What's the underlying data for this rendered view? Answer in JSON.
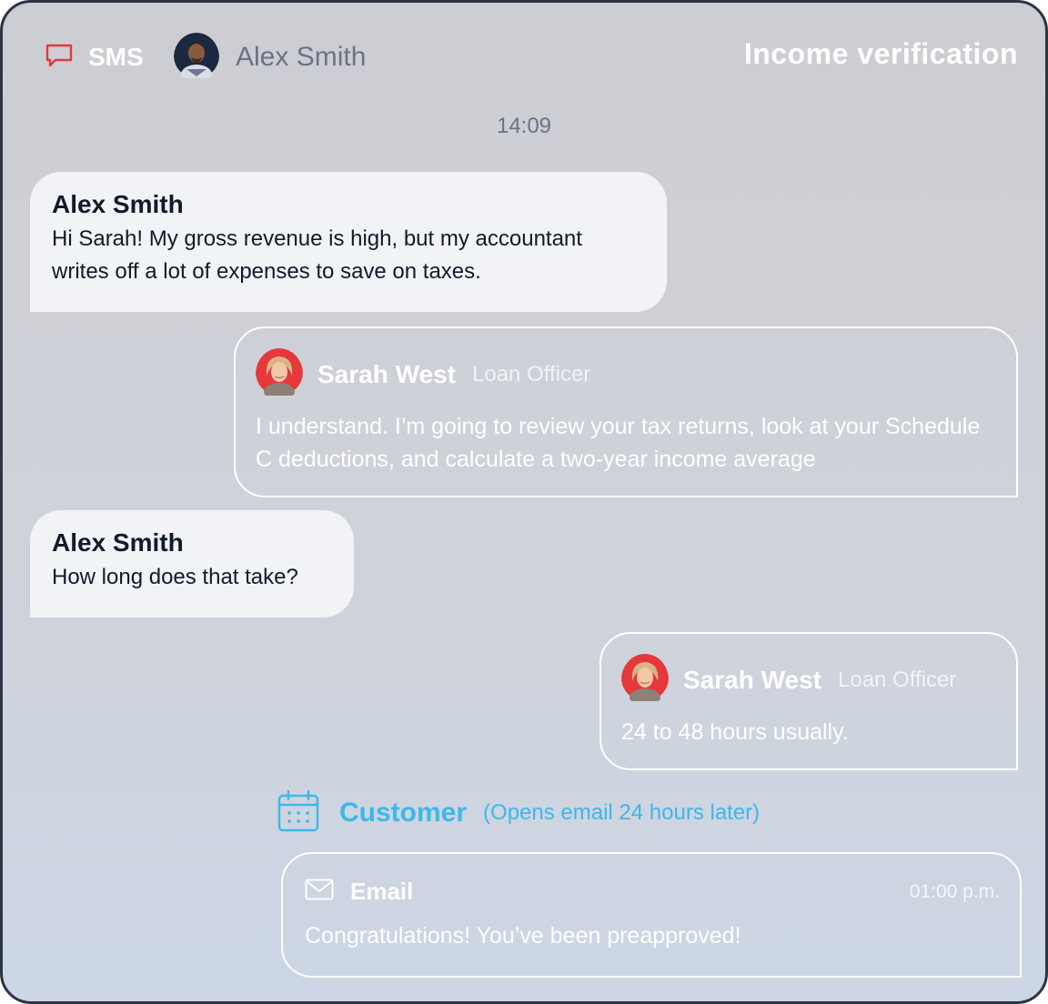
{
  "header": {
    "channel_label": "SMS",
    "channel_icon": "chat-bubble-icon",
    "contact_name": "Alex Smith",
    "title": "Income verification"
  },
  "timestamp": "14:09",
  "messages": [
    {
      "direction": "incoming",
      "sender": "Alex Smith",
      "text": "Hi Sarah! My gross revenue is high, but my accountant writes off a lot of expenses to save on taxes."
    },
    {
      "direction": "outgoing",
      "sender": "Sarah West",
      "role": "Loan Officer",
      "text": "I understand. I’m going to review your tax returns, look at your Schedule C deductions, and calculate a two-year income average"
    },
    {
      "direction": "incoming",
      "sender": "Alex Smith",
      "text": "How long does that take?"
    },
    {
      "direction": "outgoing",
      "sender": "Sarah West",
      "role": "Loan Officer",
      "text": "24 to 48 hours usually."
    }
  ],
  "event": {
    "icon": "calendar-icon",
    "actor": "Customer",
    "note": "(Opens email 24 hours later)"
  },
  "email": {
    "icon": "envelope-icon",
    "label": "Email",
    "time": "01:00 p.m.",
    "text": "Congratulations! You’ve been preapproved!"
  },
  "colors": {
    "accent_red": "#e5383b",
    "accent_cyan": "#3cb8ea",
    "incoming_bubble": "#f1f3f6",
    "frame_border": "#2c3445"
  }
}
